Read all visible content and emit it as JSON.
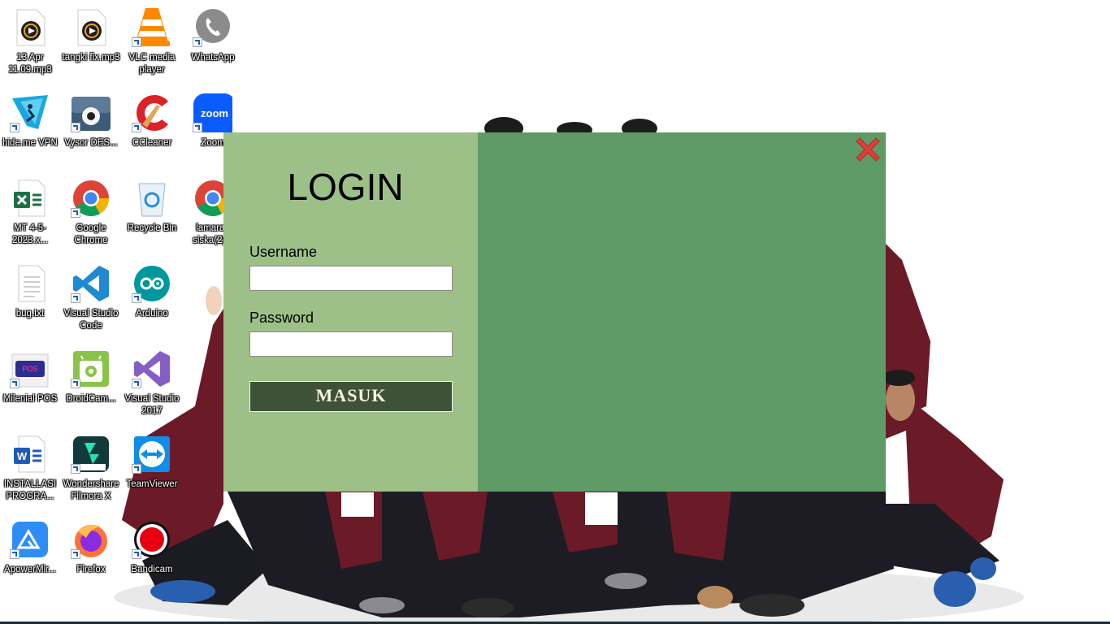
{
  "desktop": {
    "icons": [
      {
        "label": "13 Apr 11.09.mp3",
        "icon": "media-audio-file-icon"
      },
      {
        "label": "tangki fix.mp3",
        "icon": "media-audio-file-icon"
      },
      {
        "label": "VLC media player",
        "icon": "vlc-cone-icon"
      },
      {
        "label": "WhatsApp",
        "icon": "whatsapp-icon"
      },
      {
        "label": "hide.me VPN",
        "icon": "hideme-vpn-icon"
      },
      {
        "label": "Vysor DES...",
        "icon": "vysor-icon"
      },
      {
        "label": "CCleaner",
        "icon": "ccleaner-icon"
      },
      {
        "label": "Zoom",
        "icon": "zoom-icon"
      },
      {
        "label": "MT 4-5-2023.x...",
        "icon": "excel-file-icon"
      },
      {
        "label": "Google Chrome",
        "icon": "chrome-icon"
      },
      {
        "label": "Recycle Bin",
        "icon": "recycle-bin-icon"
      },
      {
        "label": "lamaran siska(2)...",
        "icon": "chrome-icon"
      },
      {
        "label": "bug.txt",
        "icon": "text-file-icon"
      },
      {
        "label": "Visual Studio Code",
        "icon": "vscode-icon"
      },
      {
        "label": "Arduino",
        "icon": "arduino-icon"
      },
      {
        "label": "Milenial POS",
        "icon": "milenial-pos-icon"
      },
      {
        "label": "DroidCam...",
        "icon": "droidcam-icon"
      },
      {
        "label": "Visual Studio 2017",
        "icon": "visual-studio-icon"
      },
      {
        "label": "INSTALLASI PROGRA...",
        "icon": "word-file-icon"
      },
      {
        "label": "Wondershare Filmora X",
        "icon": "filmora-icon"
      },
      {
        "label": "TeamViewer",
        "icon": "teamviewer-icon"
      },
      {
        "label": "ApowerMir...",
        "icon": "apowermirror-icon"
      },
      {
        "label": "Firefox",
        "icon": "firefox-icon"
      },
      {
        "label": "Bandicam",
        "icon": "bandicam-icon"
      }
    ]
  },
  "login": {
    "title": "LOGIN",
    "username_label": "Username",
    "username_value": "",
    "password_label": "Password",
    "password_value": "",
    "submit_label": "MASUK",
    "close_icon": "close-x-icon"
  },
  "colors": {
    "login_panel": "#9dc088",
    "side_panel": "#5e9b67",
    "button": "#3e5238",
    "close": "#e23b3b"
  }
}
